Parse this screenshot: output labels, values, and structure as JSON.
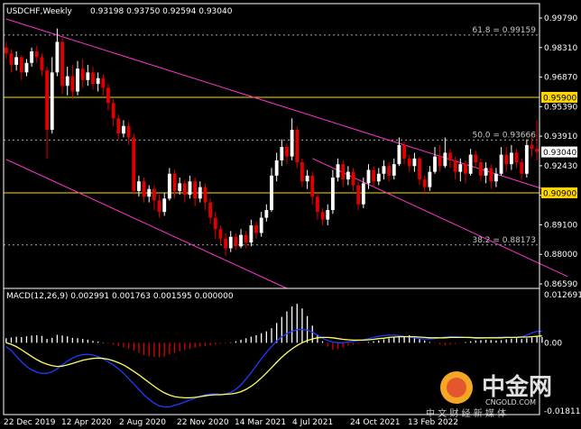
{
  "header": {
    "symbol": "USDCHF,Weekly",
    "ohlc": "0.93198 0.93750 0.92594 0.93040",
    "macd_label": "MACD(12,26,9) 0.002991 0.001763 0.001595 0.000000"
  },
  "colors": {
    "background": "#000000",
    "up": "#ffffff",
    "down": "#e00000",
    "channel": "#ff33cc",
    "fib_line": "#aaaaaa",
    "key_level": "#ffd700",
    "signal": "#ffff66",
    "macd_line": "#1f3cff"
  },
  "watermark": {
    "name": "中金网",
    "domain": "CNGOLD.COM",
    "slogan": "中 文 财 经 新 媒 体"
  },
  "chart_data": {
    "type": "candlestick",
    "price_axis": {
      "ylim": [
        0.859,
        1.0
      ],
      "ticks": [
        "0.99790",
        "0.98310",
        "0.96870",
        "0.95390",
        "0.93910",
        "0.92430",
        "0.90950",
        "0.89100",
        "0.88000",
        "0.86590"
      ]
    },
    "macd_axis": {
      "ylim": [
        -0.0188,
        0.0133
      ],
      "ticks": [
        "0.012691",
        "0.00",
        "-0.018118"
      ]
    },
    "x_labels": [
      "22 Dec 2019",
      "12 Apr 2020",
      "2 Aug 2020",
      "22 Nov 2020",
      "14 Mar 2021",
      "4 Jul 2021",
      "24 Oct 2021",
      "13 Feb 2022"
    ],
    "current_price": "0.93040",
    "key_levels": [
      {
        "price": 0.959,
        "label": "0.95900"
      },
      {
        "price": 0.909,
        "label": "0.90900"
      }
    ],
    "fib_levels": [
      {
        "price": 0.99159,
        "label": "61.8 = 0.99159"
      },
      {
        "price": 0.93666,
        "label": "50.0 = 0.93666"
      },
      {
        "price": 0.88173,
        "label": "38.2 = 0.88173"
      }
    ],
    "channel": {
      "upper": [
        [
          0,
          1.0
        ],
        [
          110,
          0.907
        ]
      ],
      "lower": [
        [
          0,
          0.9265
        ],
        [
          55,
          0.859
        ]
      ],
      "parallel": [
        [
          60,
          0.927
        ],
        [
          110,
          0.8652
        ]
      ]
    },
    "candles": [
      [
        0.985,
        0.982,
        0.988,
        0.979
      ],
      [
        0.982,
        0.976,
        0.984,
        0.972
      ],
      [
        0.976,
        0.98,
        0.983,
        0.973
      ],
      [
        0.98,
        0.972,
        0.981,
        0.968
      ],
      [
        0.972,
        0.977,
        0.979,
        0.97
      ],
      [
        0.977,
        0.983,
        0.985,
        0.975
      ],
      [
        0.983,
        0.98,
        0.986,
        0.977
      ],
      [
        0.98,
        0.973,
        0.982,
        0.97
      ],
      [
        0.973,
        0.942,
        0.975,
        0.927
      ],
      [
        0.942,
        0.972,
        0.98,
        0.94
      ],
      [
        0.972,
        0.988,
        0.995,
        0.97
      ],
      [
        0.988,
        0.965,
        0.99,
        0.961
      ],
      [
        0.965,
        0.97,
        0.975,
        0.96
      ],
      [
        0.97,
        0.962,
        0.976,
        0.958
      ],
      [
        0.962,
        0.974,
        0.978,
        0.96
      ],
      [
        0.974,
        0.968,
        0.979,
        0.964
      ],
      [
        0.968,
        0.972,
        0.976,
        0.965
      ],
      [
        0.972,
        0.966,
        0.975,
        0.963
      ],
      [
        0.966,
        0.969,
        0.972,
        0.962
      ],
      [
        0.969,
        0.964,
        0.971,
        0.96
      ],
      [
        0.964,
        0.956,
        0.966,
        0.952
      ],
      [
        0.956,
        0.948,
        0.958,
        0.944
      ],
      [
        0.948,
        0.94,
        0.95,
        0.937
      ],
      [
        0.94,
        0.944,
        0.947,
        0.938
      ],
      [
        0.944,
        0.938,
        0.946,
        0.934
      ],
      [
        0.938,
        0.91,
        0.94,
        0.908
      ],
      [
        0.91,
        0.915,
        0.918,
        0.907
      ],
      [
        0.915,
        0.907,
        0.917,
        0.904
      ],
      [
        0.907,
        0.911,
        0.913,
        0.904
      ],
      [
        0.911,
        0.905,
        0.913,
        0.9
      ],
      [
        0.905,
        0.899,
        0.908,
        0.896
      ],
      [
        0.899,
        0.906,
        0.909,
        0.897
      ],
      [
        0.906,
        0.919,
        0.922,
        0.905
      ],
      [
        0.919,
        0.91,
        0.921,
        0.906
      ],
      [
        0.91,
        0.914,
        0.917,
        0.908
      ],
      [
        0.914,
        0.908,
        0.916,
        0.904
      ],
      [
        0.908,
        0.915,
        0.918,
        0.906
      ],
      [
        0.915,
        0.906,
        0.917,
        0.902
      ],
      [
        0.906,
        0.912,
        0.915,
        0.904
      ],
      [
        0.912,
        0.904,
        0.914,
        0.9
      ],
      [
        0.904,
        0.896,
        0.906,
        0.893
      ],
      [
        0.896,
        0.89,
        0.899,
        0.885
      ],
      [
        0.89,
        0.885,
        0.892,
        0.882
      ],
      [
        0.885,
        0.88,
        0.888,
        0.876
      ],
      [
        0.88,
        0.886,
        0.889,
        0.878
      ],
      [
        0.886,
        0.881,
        0.888,
        0.879
      ],
      [
        0.881,
        0.887,
        0.89,
        0.88
      ],
      [
        0.887,
        0.883,
        0.889,
        0.88
      ],
      [
        0.883,
        0.892,
        0.895,
        0.881
      ],
      [
        0.892,
        0.888,
        0.894,
        0.885
      ],
      [
        0.888,
        0.896,
        0.899,
        0.886
      ],
      [
        0.896,
        0.9,
        0.903,
        0.894
      ],
      [
        0.9,
        0.918,
        0.922,
        0.899
      ],
      [
        0.918,
        0.926,
        0.93,
        0.915
      ],
      [
        0.926,
        0.933,
        0.937,
        0.923
      ],
      [
        0.933,
        0.928,
        0.935,
        0.924
      ],
      [
        0.928,
        0.942,
        0.948,
        0.926
      ],
      [
        0.942,
        0.925,
        0.944,
        0.922
      ],
      [
        0.925,
        0.915,
        0.927,
        0.912
      ],
      [
        0.915,
        0.918,
        0.921,
        0.911
      ],
      [
        0.918,
        0.907,
        0.92,
        0.903
      ],
      [
        0.907,
        0.899,
        0.909,
        0.895
      ],
      [
        0.899,
        0.895,
        0.901,
        0.892
      ],
      [
        0.895,
        0.9,
        0.903,
        0.892
      ],
      [
        0.9,
        0.917,
        0.921,
        0.898
      ],
      [
        0.917,
        0.924,
        0.927,
        0.915
      ],
      [
        0.924,
        0.916,
        0.926,
        0.912
      ],
      [
        0.916,
        0.92,
        0.923,
        0.913
      ],
      [
        0.92,
        0.913,
        0.922,
        0.91
      ],
      [
        0.913,
        0.903,
        0.915,
        0.9
      ],
      [
        0.903,
        0.914,
        0.917,
        0.901
      ],
      [
        0.914,
        0.921,
        0.924,
        0.911
      ],
      [
        0.921,
        0.915,
        0.923,
        0.912
      ],
      [
        0.915,
        0.919,
        0.922,
        0.913
      ],
      [
        0.919,
        0.923,
        0.926,
        0.916
      ],
      [
        0.923,
        0.918,
        0.925,
        0.915
      ],
      [
        0.918,
        0.924,
        0.927,
        0.916
      ],
      [
        0.924,
        0.934,
        0.938,
        0.923
      ],
      [
        0.934,
        0.927,
        0.936,
        0.924
      ],
      [
        0.927,
        0.923,
        0.929,
        0.92
      ],
      [
        0.923,
        0.927,
        0.93,
        0.92
      ],
      [
        0.927,
        0.916,
        0.928,
        0.913
      ],
      [
        0.916,
        0.912,
        0.918,
        0.909
      ],
      [
        0.912,
        0.92,
        0.923,
        0.91
      ],
      [
        0.92,
        0.928,
        0.933,
        0.919
      ],
      [
        0.928,
        0.923,
        0.934,
        0.92
      ],
      [
        0.923,
        0.93,
        0.938,
        0.922
      ],
      [
        0.93,
        0.926,
        0.932,
        0.922
      ],
      [
        0.926,
        0.92,
        0.928,
        0.916
      ],
      [
        0.92,
        0.924,
        0.927,
        0.915
      ],
      [
        0.924,
        0.919,
        0.926,
        0.914
      ],
      [
        0.919,
        0.929,
        0.932,
        0.918
      ],
      [
        0.929,
        0.925,
        0.931,
        0.922
      ],
      [
        0.925,
        0.918,
        0.927,
        0.915
      ],
      [
        0.918,
        0.922,
        0.925,
        0.914
      ],
      [
        0.922,
        0.915,
        0.924,
        0.911
      ],
      [
        0.915,
        0.919,
        0.922,
        0.912
      ],
      [
        0.919,
        0.929,
        0.933,
        0.918
      ],
      [
        0.929,
        0.924,
        0.933,
        0.92
      ],
      [
        0.924,
        0.93,
        0.934,
        0.921
      ],
      [
        0.93,
        0.925,
        0.932,
        0.922
      ],
      [
        0.925,
        0.919,
        0.927,
        0.916
      ],
      [
        0.919,
        0.934,
        0.937,
        0.917
      ],
      [
        0.934,
        0.932,
        0.938,
        0.928
      ],
      [
        0.932,
        0.9304,
        0.947,
        0.9259
      ]
    ],
    "macd_hist": [
      0.0012,
      0.0014,
      0.0016,
      0.0015,
      0.0017,
      0.0019,
      0.002,
      0.0018,
      0.001,
      0.0013,
      0.0021,
      0.0019,
      0.0017,
      0.0013,
      0.0012,
      0.001,
      0.0008,
      0.0005,
      0.0003,
      0.0001,
      -0.0002,
      -0.0005,
      -0.0008,
      -0.0012,
      -0.0015,
      -0.002,
      -0.0026,
      -0.0032,
      -0.0035,
      -0.0037,
      -0.0038,
      -0.0036,
      -0.003,
      -0.0026,
      -0.0022,
      -0.0019,
      -0.0016,
      -0.0013,
      -0.001,
      -0.0008,
      -0.0006,
      -0.0004,
      -0.0003,
      -0.0002,
      0.0001,
      0.0004,
      0.0008,
      0.0012,
      0.0016,
      0.002,
      0.0025,
      0.003,
      0.0038,
      0.0052,
      0.0068,
      0.0082,
      0.0095,
      0.0102,
      0.009,
      0.007,
      0.0045,
      0.0022,
      0.0004,
      -0.001,
      -0.0018,
      -0.0016,
      -0.0012,
      -0.0008,
      -0.0005,
      -0.0003,
      -0.0001,
      0.0002,
      0.0004,
      0.0006,
      0.0009,
      0.0012,
      0.0014,
      0.0016,
      0.0018,
      0.002,
      0.0015,
      0.001,
      0.0006,
      0.0002,
      -0.0002,
      -0.0004,
      -0.0006,
      -0.0005,
      -0.0003,
      -0.0001,
      0.0002,
      0.0004,
      0.0006,
      0.0007,
      0.0008,
      0.0007,
      0.0006,
      0.0007,
      0.0009,
      0.0011,
      0.0012,
      0.001,
      0.0012,
      0.0014,
      0.0016,
      0.0015
    ],
    "macd_line": [
      -0.001,
      -0.002,
      -0.0035,
      -0.005,
      -0.0062,
      -0.0071,
      -0.0077,
      -0.008,
      -0.008,
      -0.0076,
      -0.0068,
      -0.0058,
      -0.0048,
      -0.004,
      -0.0034,
      -0.0031,
      -0.003,
      -0.0032,
      -0.0036,
      -0.0042,
      -0.005,
      -0.0058,
      -0.0068,
      -0.008,
      -0.0094,
      -0.0108,
      -0.0122,
      -0.0136,
      -0.0148,
      -0.0158,
      -0.0165,
      -0.0168,
      -0.0168,
      -0.0164,
      -0.016,
      -0.0155,
      -0.015,
      -0.0145,
      -0.014,
      -0.0136,
      -0.0134,
      -0.0134,
      -0.0135,
      -0.0134,
      -0.013,
      -0.0122,
      -0.011,
      -0.0095,
      -0.0078,
      -0.006,
      -0.0042,
      -0.0025,
      -0.001,
      0.0005,
      0.0016,
      0.0024,
      0.003,
      0.0034,
      0.0035,
      0.0033,
      0.0028,
      0.002,
      0.0012,
      0.0006,
      0.0002,
      0.0,
      0.0,
      0.0002,
      0.0004,
      0.0006,
      0.0008,
      0.0011,
      0.0014,
      0.0017,
      0.0019,
      0.002,
      0.002,
      0.0019,
      0.0017,
      0.0015,
      0.0013,
      0.0011,
      0.001,
      0.001,
      0.0011,
      0.0013,
      0.0015,
      0.0016,
      0.0016,
      0.0015,
      0.0014,
      0.0013,
      0.0012,
      0.0012,
      0.0013,
      0.0014,
      0.0014,
      0.0015,
      0.0015,
      0.0014,
      0.0015,
      0.0016,
      0.002,
      0.0026,
      0.003,
      0.003
    ],
    "signal_line": [
      0.0,
      -0.0004,
      -0.001,
      -0.0018,
      -0.0027,
      -0.0036,
      -0.0044,
      -0.0051,
      -0.0056,
      -0.006,
      -0.0062,
      -0.0061,
      -0.0058,
      -0.0054,
      -0.005,
      -0.0046,
      -0.0043,
      -0.0041,
      -0.004,
      -0.0041,
      -0.0043,
      -0.0047,
      -0.0052,
      -0.0058,
      -0.0066,
      -0.0075,
      -0.0084,
      -0.0094,
      -0.0104,
      -0.0114,
      -0.0123,
      -0.0131,
      -0.0137,
      -0.0141,
      -0.0143,
      -0.0144,
      -0.0144,
      -0.0143,
      -0.0141,
      -0.0139,
      -0.0137,
      -0.0136,
      -0.0136,
      -0.0135,
      -0.0134,
      -0.0132,
      -0.0128,
      -0.0122,
      -0.0114,
      -0.0104,
      -0.0092,
      -0.0079,
      -0.0065,
      -0.0051,
      -0.0038,
      -0.0026,
      -0.0016,
      -0.0007,
      0.0,
      0.0006,
      0.001,
      0.0013,
      0.0014,
      0.0014,
      0.0013,
      0.0011,
      0.0009,
      0.0008,
      0.0007,
      0.0007,
      0.0007,
      0.0008,
      0.0009,
      0.0011,
      0.0012,
      0.0014,
      0.0015,
      0.0016,
      0.0016,
      0.0016,
      0.0016,
      0.0015,
      0.0014,
      0.0013,
      0.0013,
      0.0013,
      0.0013,
      0.0014,
      0.0014,
      0.0014,
      0.0014,
      0.0014,
      0.0013,
      0.0013,
      0.0013,
      0.0013,
      0.0013,
      0.0013,
      0.0014,
      0.0014,
      0.0014,
      0.0015,
      0.0015,
      0.0016,
      0.0017,
      0.0018
    ]
  }
}
